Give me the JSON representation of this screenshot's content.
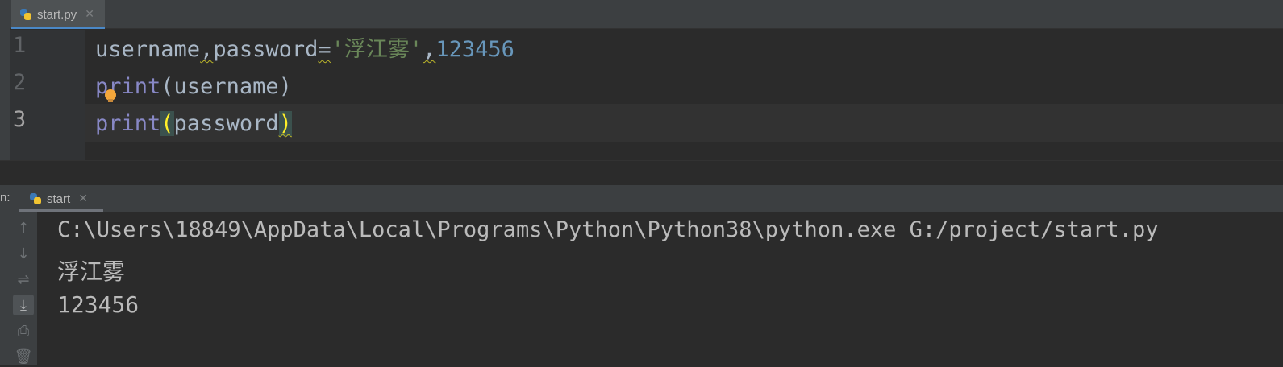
{
  "editor_tab": {
    "filename": "start.py",
    "close": "✕"
  },
  "editor": {
    "line_numbers": [
      "1",
      "2",
      "3"
    ],
    "line1": {
      "ident": "username",
      "comma1": ",",
      "ident2": "password",
      "eq": "=",
      "string": "'浮江雾'",
      "comma2": ",",
      "number": "123456"
    },
    "line2": {
      "func": "print",
      "open": "(",
      "arg": "username",
      "close": ")"
    },
    "line3": {
      "func": "print",
      "open": "(",
      "arg": "password",
      "close": ")"
    }
  },
  "run_panel": {
    "label": "n:",
    "tab": {
      "name": "start",
      "close": "✕"
    },
    "toolbar": [
      {
        "name": "up-arrow-icon",
        "glyph": "↑"
      },
      {
        "name": "down-arrow-icon",
        "glyph": "↓"
      },
      {
        "name": "soft-wrap-icon",
        "glyph": "⇌"
      },
      {
        "name": "scroll-to-end-icon",
        "glyph": "⤓"
      },
      {
        "name": "print-icon",
        "glyph": "⎙"
      },
      {
        "name": "trash-icon",
        "glyph": "🗑"
      }
    ],
    "output": [
      "C:\\Users\\18849\\AppData\\Local\\Programs\\Python\\Python38\\python.exe G:/project/start.py",
      "浮江雾",
      "123456"
    ]
  },
  "colors": {
    "keyword": "#8888c6",
    "string": "#6a8759",
    "number": "#6897bb",
    "text": "#a9b7c6"
  }
}
